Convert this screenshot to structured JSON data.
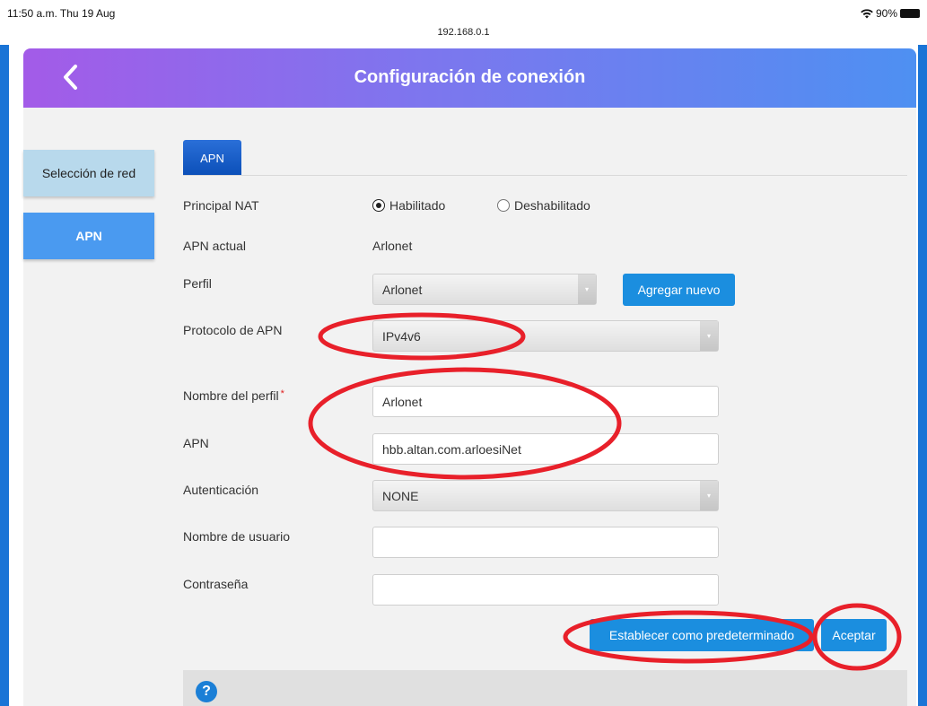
{
  "status_bar": {
    "time": "11:50 a.m.  Thu 19 Aug",
    "url": "192.168.0.1",
    "battery": "90%",
    "wifi_icon": "wifi-icon",
    "battery_icon": "battery-icon"
  },
  "header": {
    "title": "Configuración de conexión",
    "back_icon": "chevron-left-icon"
  },
  "sidebar": {
    "items": [
      {
        "label": "Selección de red",
        "active": false
      },
      {
        "label": "APN",
        "active": true
      }
    ]
  },
  "tab": {
    "label": "APN"
  },
  "form": {
    "nat": {
      "label": "Principal NAT",
      "options": [
        {
          "label": "Habilitado",
          "selected": true
        },
        {
          "label": "Deshabilitado",
          "selected": false
        }
      ]
    },
    "current_apn": {
      "label": "APN actual",
      "value": "Arlonet"
    },
    "profile": {
      "label": "Perfil",
      "value": "Arlonet",
      "add_button": "Agregar nuevo"
    },
    "protocol": {
      "label": "Protocolo de APN",
      "value": "IPv4v6"
    },
    "profile_name": {
      "label": "Nombre del perfil",
      "required_mark": "*",
      "value": "Arlonet"
    },
    "apn": {
      "label": "APN",
      "value": "hbb.altan.com.arloesiNet"
    },
    "auth": {
      "label": "Autenticación",
      "value": "NONE"
    },
    "username": {
      "label": "Nombre de usuario",
      "value": ""
    },
    "password": {
      "label": "Contraseña",
      "value": ""
    }
  },
  "actions": {
    "set_default": "Establecer como predeterminado",
    "accept": "Aceptar"
  },
  "help": {
    "icon": "help-icon",
    "glyph": "?"
  },
  "colors": {
    "frame": "#1a74d6",
    "header_gradient_start": "#a35be8",
    "header_gradient_end": "#4e90f2",
    "button": "#1b8edf",
    "annotation_red": "#e8202a"
  }
}
